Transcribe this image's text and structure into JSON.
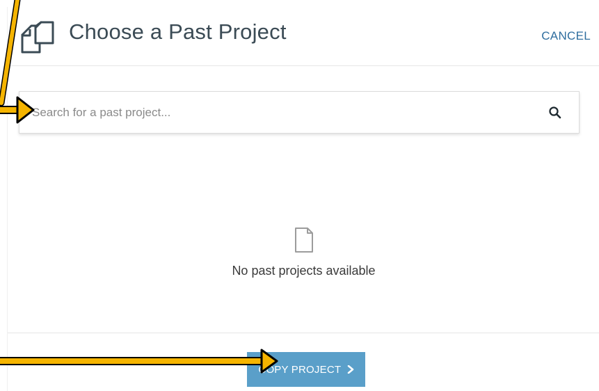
{
  "dialog": {
    "title": "Choose a Past Project",
    "cancel_label": "CANCEL",
    "header_icon": "copy-documents-icon"
  },
  "search": {
    "placeholder": "Search for a past project...",
    "value": "",
    "icon": "search-icon"
  },
  "empty_state": {
    "icon": "document-icon",
    "message": "No past projects available"
  },
  "footer": {
    "copy_button_label": "COPY PROJECT",
    "copy_button_icon": "chevron-right-icon"
  },
  "colors": {
    "accent_blue": "#2f6e9f",
    "button_blue": "#5a9fc9",
    "annotation_arrow": "#f5b400",
    "title_text": "#3b4b55"
  }
}
